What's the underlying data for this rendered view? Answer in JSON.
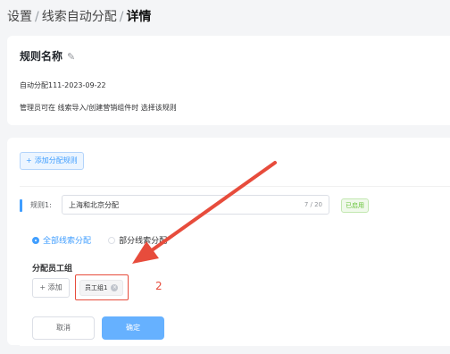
{
  "breadcrumb": {
    "items": [
      "设置",
      "线索自动分配",
      "详情"
    ],
    "separator": "/"
  },
  "rule_card": {
    "title": "规则名称",
    "edit_icon": "edit-icon",
    "rule_id": "自动分配111-2023-09-22",
    "description": "管理员可在 线索导入/创建营销组件时 选择该规则"
  },
  "config": {
    "add_rule_label": "添加分配规则",
    "rule_label": "规则1:",
    "rule_name_value": "上海和北京分配",
    "char_count": "7 / 20",
    "status_badge": "已启用",
    "radio_options": [
      "全部线索分配",
      "部分线索分配"
    ],
    "selected_option": "全部线索分配",
    "group_label": "分配员工组",
    "add_member_label": "添加",
    "tags": [
      {
        "label": "员工组1"
      }
    ],
    "annotation_number": "2",
    "cancel_label": "取消",
    "confirm_label": "确定"
  },
  "colors": {
    "accent": "#409eff",
    "annotation": "#e74c3c",
    "success": "#67c23a"
  }
}
